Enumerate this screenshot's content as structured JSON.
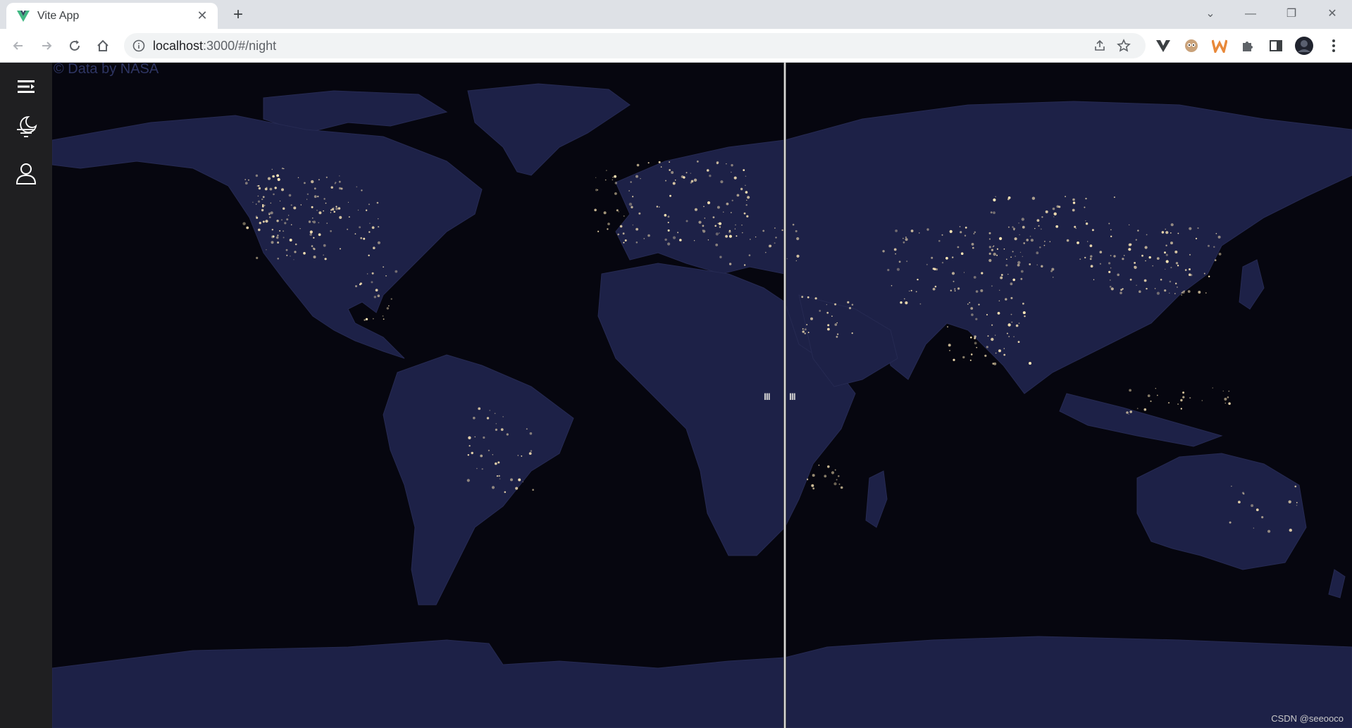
{
  "browser": {
    "tab": {
      "title": "Vite App",
      "favicon": "vite-logo",
      "close_glyph": "✕"
    },
    "new_tab_glyph": "+",
    "window_controls": {
      "tab_search": "⌄",
      "minimize": "—",
      "restore": "❐",
      "close": "✕"
    },
    "address": {
      "host": "localhost",
      "rest": ":3000/#/night"
    },
    "omnibox_icons": [
      "share-icon",
      "bookmark-star-icon"
    ],
    "extensions": [
      "vite-extension-icon",
      "owl-extension-icon",
      "w-extension-icon",
      "puzzle-extensions-icon",
      "side-panel-icon",
      "profile-avatar",
      "kebab-menu-icon"
    ]
  },
  "sidebar": {
    "items": [
      {
        "icon": "menu-toggle-icon"
      },
      {
        "icon": "night-moon-icon"
      },
      {
        "icon": "user-icon"
      }
    ]
  },
  "map": {
    "attribution": "© Data by NASA",
    "swipe_grip_left": "III",
    "swipe_grip_right": "III",
    "land_color": "#2a2e58",
    "ocean_color": "#06060f",
    "city_light_color": "#ffe9b8"
  },
  "watermark": "CSDN @seeooco"
}
